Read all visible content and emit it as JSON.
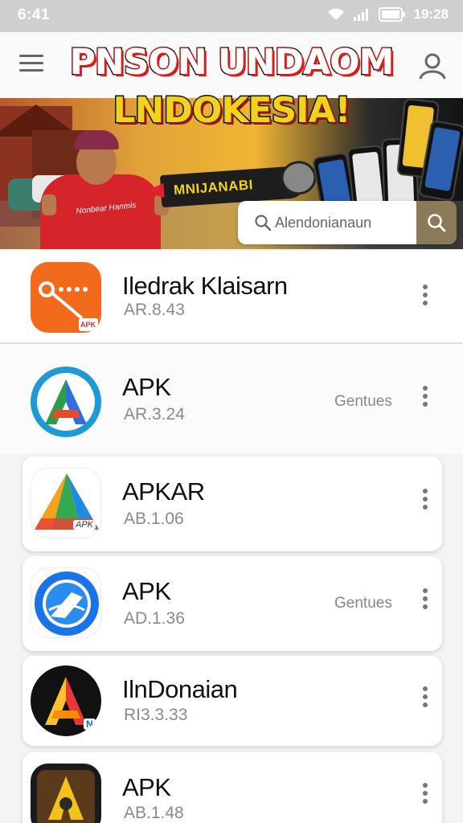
{
  "status_bar": {
    "time": "6:41",
    "clock": "19:28"
  },
  "header": {
    "title_line1": "PNSON UNDAOM",
    "title_line2": "LNDOKESIA!"
  },
  "banner": {
    "badge_text": "MNIJANABI",
    "shirt_text": "Nonbear Hanmis"
  },
  "search": {
    "placeholder": "Alendonianaun"
  },
  "apps": [
    {
      "name": "Iledrak Klaisarn",
      "version": "AR.8.43",
      "genre": ""
    },
    {
      "name": "APK",
      "version": "AR.3.24",
      "genre": "Gentues"
    },
    {
      "name": "APKAR",
      "version": "AB.1.06",
      "genre": ""
    },
    {
      "name": "APK",
      "version": "AD.1.36",
      "genre": "Gentues"
    },
    {
      "name": "IlnDonaian",
      "version": "RI3.3.33",
      "genre": ""
    },
    {
      "name": "APK",
      "version": "AB.1.48",
      "genre": ""
    }
  ],
  "icon_labels": {
    "app1_badge": "APK",
    "app3_badge": "APK",
    "app5_badge": "N"
  },
  "colors": {
    "status_bar": "#cfcfcf",
    "search_button": "#8a7a57",
    "headline_yellow": "#f2d31b",
    "headline_red": "#d71c1c",
    "banner_shirt": "#d5242a"
  }
}
